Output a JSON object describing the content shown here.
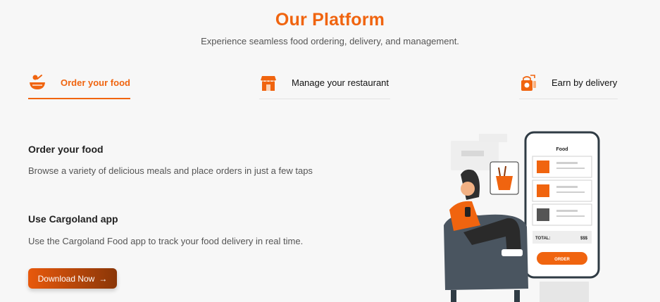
{
  "header": {
    "title": "Our Platform",
    "subtitle": "Experience seamless food ordering, delivery, and management."
  },
  "tabs": [
    {
      "label": "Order your food",
      "icon": "food-bowl-icon",
      "active": true
    },
    {
      "label": "Manage your restaurant",
      "icon": "store-icon",
      "active": false
    },
    {
      "label": "Earn by delivery",
      "icon": "delivery-bag-icon",
      "active": false
    }
  ],
  "content": {
    "section1_heading": "Order your food",
    "section1_text": "Browse a variety of delicious meals and place orders in just a few taps",
    "section2_heading": "Use Cargoland app",
    "section2_text": "Use the Cargoland Food app to track your food delivery in real time.",
    "download_label": "Download Now",
    "download_arrow": "→"
  },
  "phone": {
    "screen_title": "Food",
    "total_label": "TOTAL:",
    "total_value": "$$$",
    "order_label": "ORDER"
  },
  "colors": {
    "accent": "#f0640f",
    "button_gradient_start": "#e8590c",
    "button_gradient_end": "#8a3608"
  }
}
